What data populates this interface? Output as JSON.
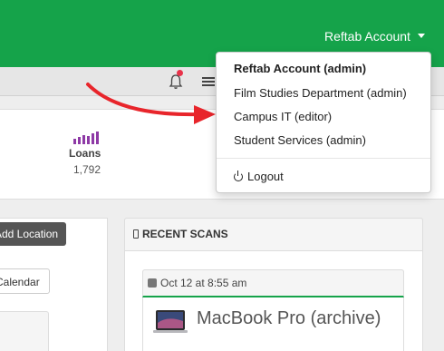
{
  "topbar": {
    "account_label": "Reftab Account",
    "brand_color": "#15a34a"
  },
  "account_menu": {
    "items": [
      {
        "label": "Reftab Account (admin)",
        "bold": true
      },
      {
        "label": "Film Studies Department (admin)"
      },
      {
        "label": "Campus IT (editor)"
      },
      {
        "label": "Student Services (admin)"
      }
    ],
    "logout_label": "Logout"
  },
  "stats": {
    "loans_label": "Loans",
    "loans_value": "1,792",
    "icon_color": "#8e3aa6"
  },
  "left_panel": {
    "add_location_label": "Add Location",
    "calendar_label": "Calendar"
  },
  "recent_scans": {
    "title": "RECENT SCANS",
    "scan_date": "Oct 12 at 8:55 am",
    "item_name": "MacBook Pro (archive)"
  },
  "icons": [
    "bell-icon",
    "list-icon",
    "loans-bars-icon",
    "mobile-icon",
    "rss-icon",
    "laptop-image",
    "power-icon",
    "caret-down-icon"
  ],
  "annotation": {
    "arrow_color": "#e8252b"
  }
}
